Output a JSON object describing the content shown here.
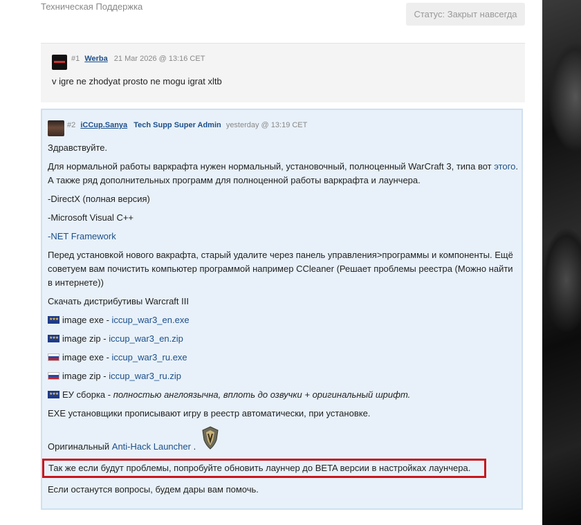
{
  "header": {
    "section_title": "Техническая Поддержка",
    "status_label": "Статус: Закрыт навсегда"
  },
  "post1": {
    "number": "#1",
    "author": "Werba",
    "timestamp": "21 Mar 2026 @ 13:16 CET",
    "text": "v igre ne zhodyat prosto ne mogu igrat xltb"
  },
  "post2": {
    "number": "#2",
    "author": "iCCup.Sanya",
    "role": "Tech Supp Super Admin",
    "timestamp": "yesterday @ 13:19 CET",
    "greeting": "Здравствуйте.",
    "intro_before_link": "Для нормальной работы варкрафта нужен нормальный, установочный, полноценный WarCraft 3, типа вот",
    "intro_link": "этого",
    "intro_after_link": ". А также ряд дополнительных программ для полноценной работы варкрафта и лаунчера.",
    "req_directx": "-DirectX (полная версия)",
    "req_vcpp": "-Microsoft Visual C++",
    "req_net": "-NET Framework",
    "uninstall_text": "Перед установкой нового вакрафта, старый удалите через панель управления>программы и компоненты. Ещё советуем вам почистить компьютер программой например CCleaner (Решает проблемы реестра (Можно найти в интернете))",
    "downloads_title": "Скачать дистрибутивы Warcraft III",
    "downloads": [
      {
        "flag": "eu-flag-icon",
        "label": "image exe - ",
        "link": "iccup_war3_en.exe"
      },
      {
        "flag": "eu-flag-icon",
        "label": "image zip - ",
        "link": "iccup_war3_en.zip"
      },
      {
        "flag": "ru-flag-icon",
        "label": "image exe - ",
        "link": "iccup_war3_ru.exe"
      },
      {
        "flag": "ru-flag-icon",
        "label": "image zip - ",
        "link": "iccup_war3_ru.zip"
      }
    ],
    "eu_build_label": "ЕУ сборка - ",
    "eu_build_desc": "полностью англоязычна, вплоть до озвучки + оригинальный шрифт.",
    "exe_note": "EXE установщики прописывают игру в реестр автоматически, при установке.",
    "original_label": "Оригинальный ",
    "launcher_link": "Anti-Hack Launcher",
    "launcher_after": " .",
    "beta_note": "Так же если будут проблемы, попробуйте обновить лаунчер до BETA версии в настройках лаунчера.",
    "closing": "Если останутся вопросы, будем дары вам помочь.",
    "colors": {
      "link": "#1d4f8a",
      "highlight_border": "#c8161d",
      "post_bg": "#e8f1f9"
    }
  }
}
